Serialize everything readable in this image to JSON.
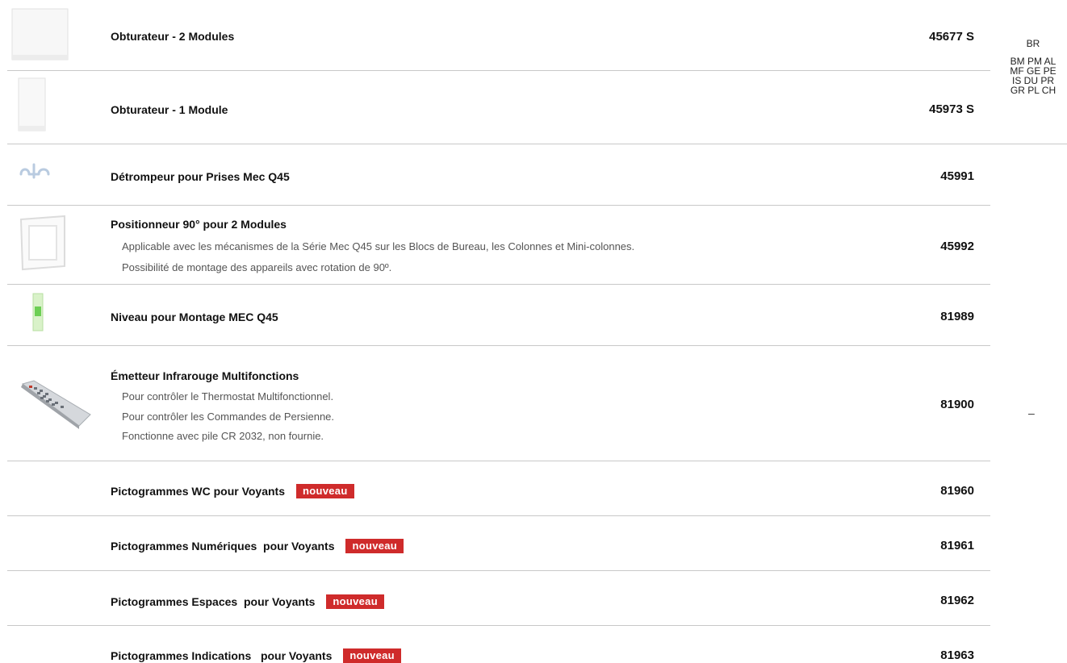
{
  "finishes": {
    "line1": "BR",
    "line2": "BM PM AL",
    "line3": "MF GE PE",
    "line4": "IS DU PR",
    "line5": "GR PL CH",
    "dash": "–"
  },
  "products": [
    {
      "name": "Obturateur - 2 Modules",
      "code": "45677 S",
      "image": "blank-plate-2-modules"
    },
    {
      "name": "Obturateur - 1 Module",
      "code": "45973 S",
      "image": "blank-plate-1-module"
    },
    {
      "name": "Détrompeur pour Prises Mec Q45",
      "code": "45991",
      "image": "polarizer-clip"
    },
    {
      "name": "Positionneur 90° pour 2 Modules",
      "code": "45992",
      "image": "positioner-frame",
      "desc": [
        "Applicable avec les mécanismes de la Série Mec Q45 sur les Blocs de Bureau, les Colonnes et Mini-colonnes.",
        "Possibilité de montage des appareils avec rotation de 90º."
      ]
    },
    {
      "name": "Niveau pour Montage MEC Q45",
      "code": "81989",
      "image": "spirit-level"
    },
    {
      "name": "Émetteur Infrarouge Multifonctions",
      "code": "81900",
      "image": "remote-control",
      "desc": [
        "Pour contrôler le Thermostat Multifonctionnel.",
        "Pour contrôler les Commandes de Persienne.",
        "Fonctionne avec pile CR 2032, non fournie."
      ]
    },
    {
      "name": "Pictogrammes WC pour Voyants",
      "code": "81960",
      "badge": "nouveau"
    },
    {
      "name": "Pictogrammes Numériques  pour Voyants",
      "code": "81961",
      "badge": "nouveau"
    },
    {
      "name": "Pictogrammes Espaces  pour Voyants",
      "code": "81962",
      "badge": "nouveau"
    },
    {
      "name": "Pictogrammes Indications   pour Voyants",
      "code": "81963",
      "badge": "nouveau"
    }
  ],
  "colors": {
    "badge": "#cf2b2b",
    "separator": "#c8c8c8"
  }
}
